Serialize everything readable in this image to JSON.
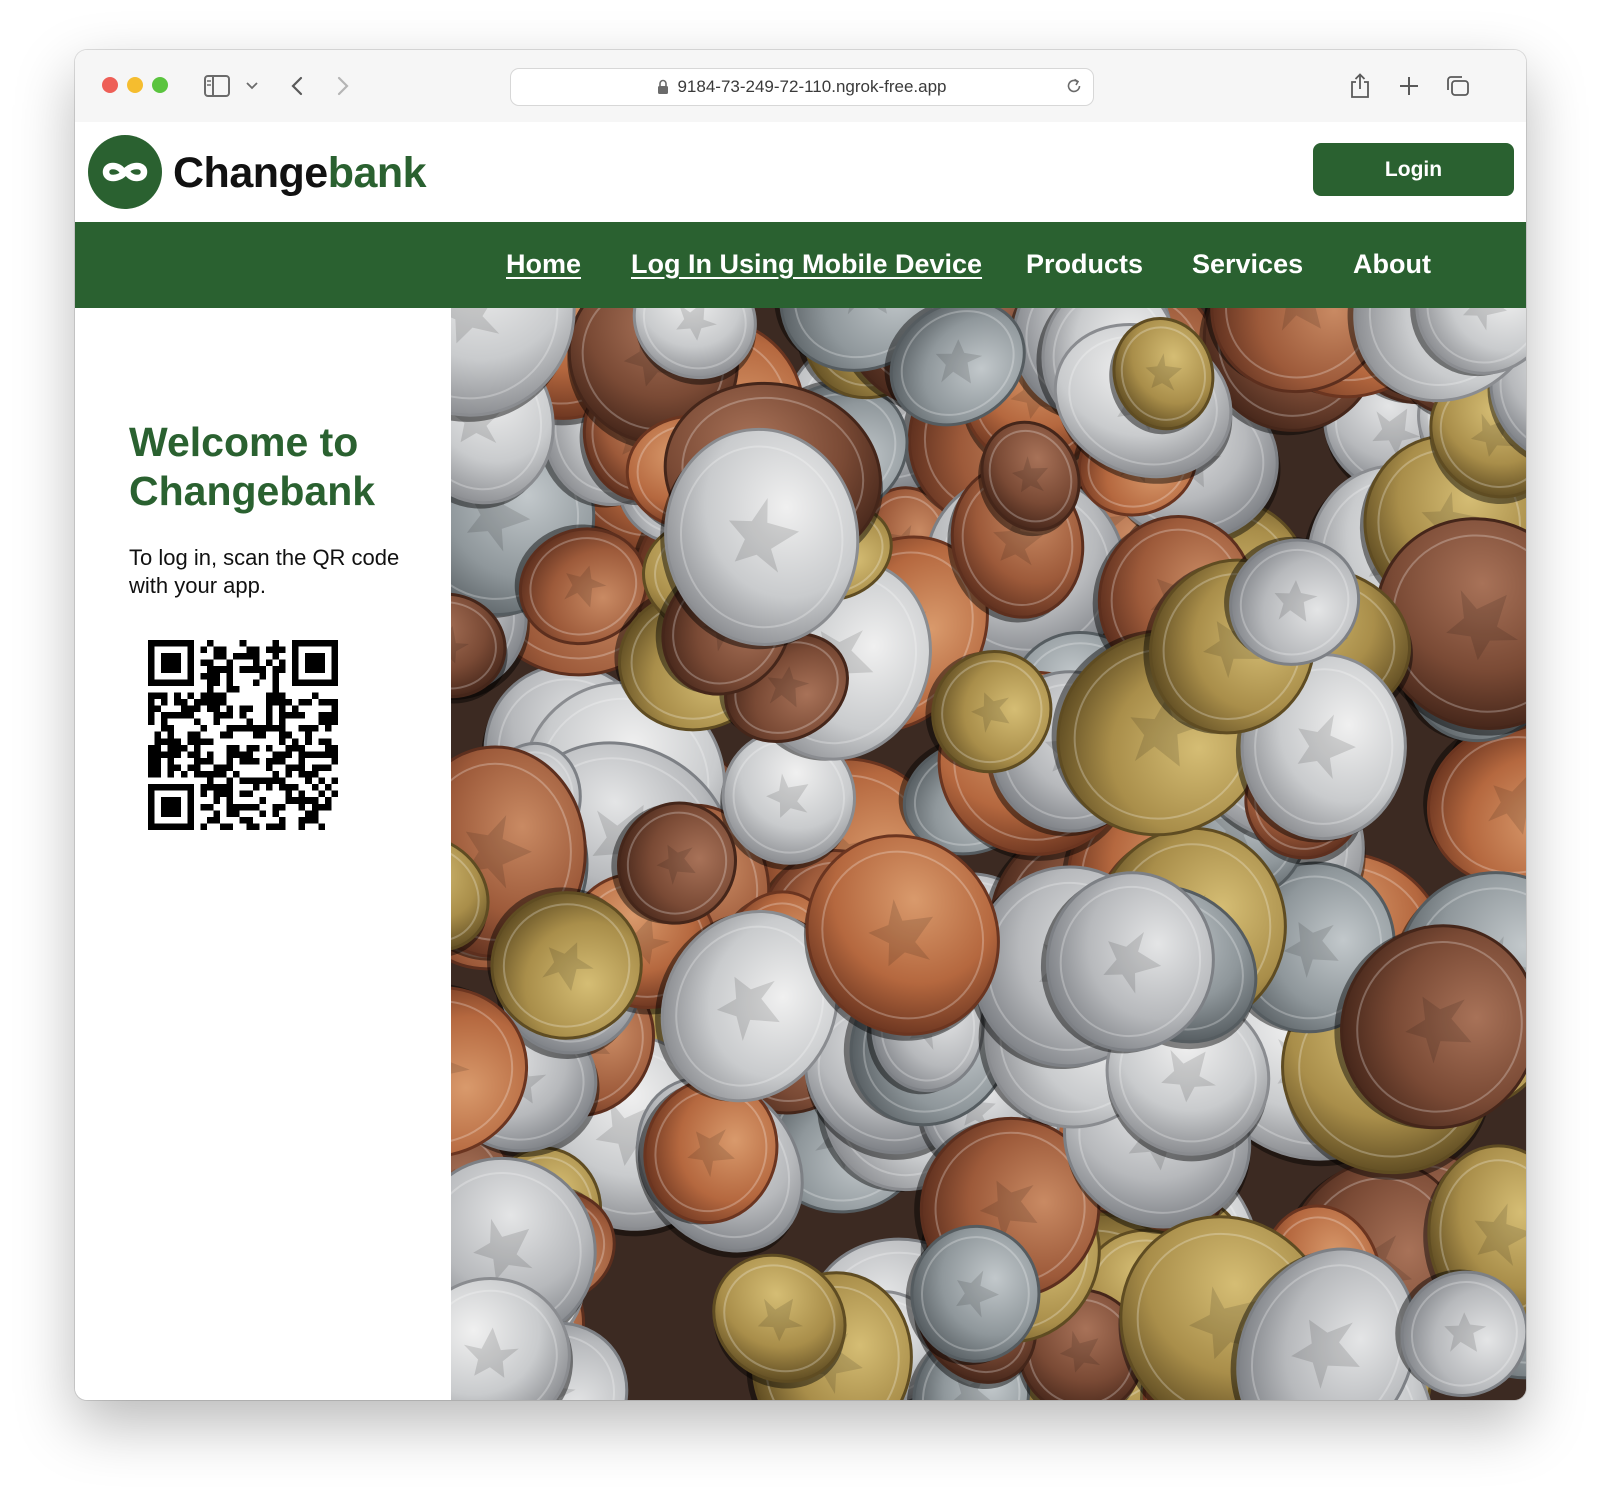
{
  "browser": {
    "url": "9184-73-249-72-110.ngrok-free.app"
  },
  "header": {
    "brand_part1": "Change",
    "brand_part2": "bank",
    "login_label": "Login"
  },
  "nav": {
    "items": [
      {
        "label": "Home"
      },
      {
        "label": "Log In Using Mobile Device"
      },
      {
        "label": "Products"
      },
      {
        "label": "Services"
      },
      {
        "label": "About"
      }
    ]
  },
  "main": {
    "welcome_heading": "Welcome to Changebank",
    "instructions": "To log in, scan the QR code with your app.",
    "qr_icon": "qr-code",
    "hero_image": "pile-of-coins"
  },
  "colors": {
    "brand_green": "#2a6130",
    "text_dark": "#111111"
  }
}
